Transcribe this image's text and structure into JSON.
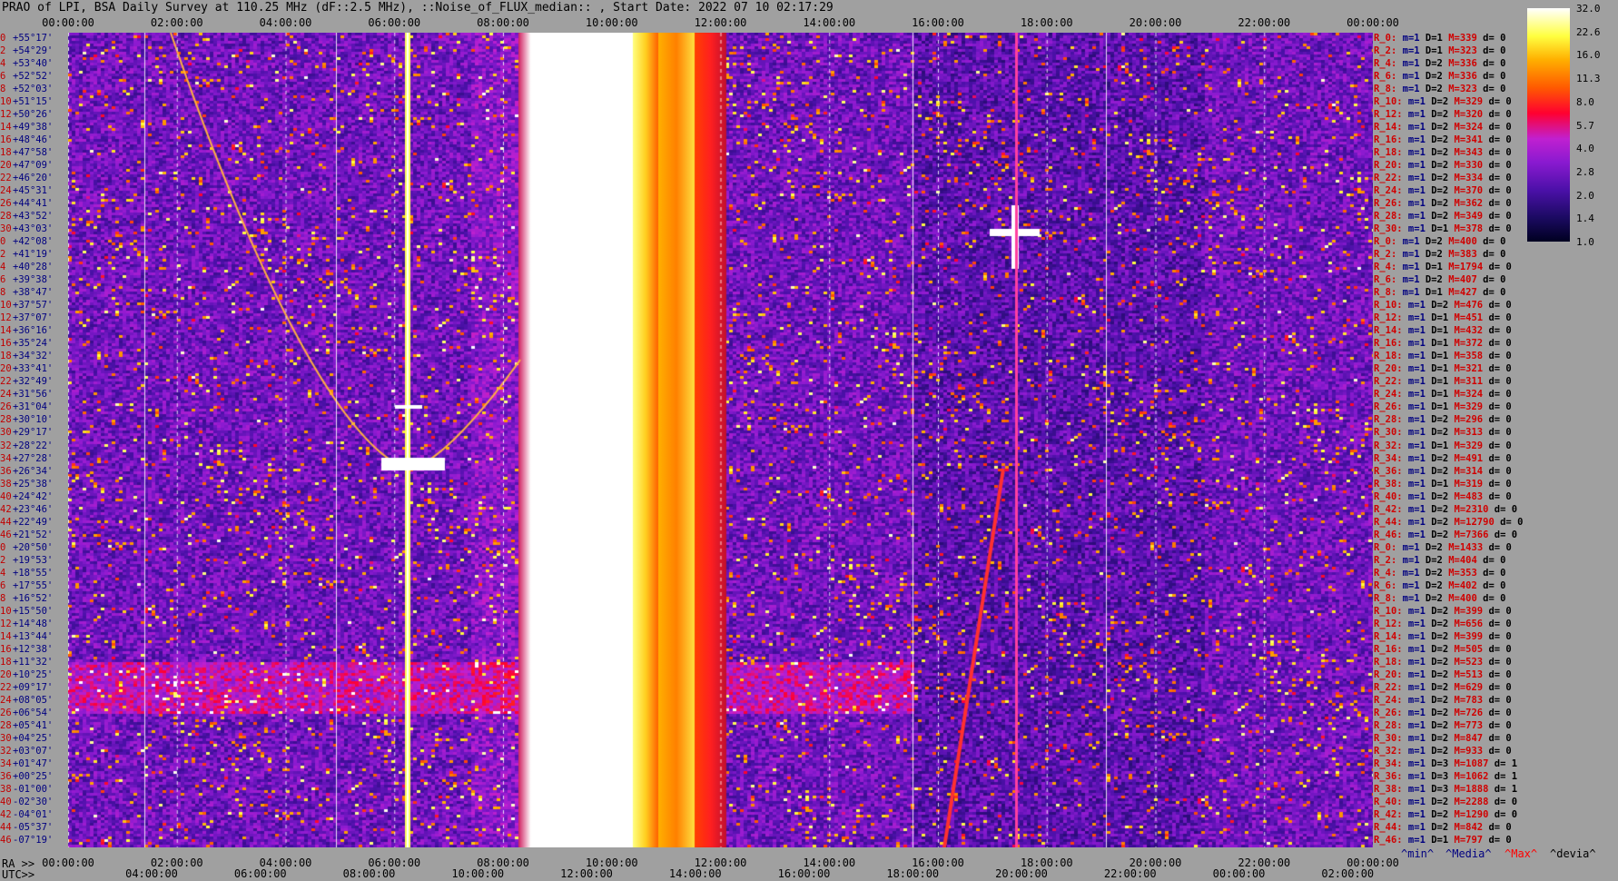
{
  "title": "PRAO of LPI, BSA Daily Survey at 110.25 MHz (dF::2.5 MHz), ::Noise_of_FLUX_median:: , Start Date: 2022 07 10 02:17:29",
  "chart_data": {
    "type": "heatmap",
    "title": "PRAO of LPI, BSA Daily Survey at 110.25 MHz (dF::2.5 MHz), ::Noise_of_FLUX_median:: , Start Date: 2022 07 10 02:17:29",
    "top_axis_ticks": [
      "00:00:00",
      "02:00:00",
      "04:00:00",
      "06:00:00",
      "08:00:00",
      "10:00:00",
      "12:00:00",
      "14:00:00",
      "16:00:00",
      "18:00:00",
      "20:00:00",
      "22:00:00",
      "00:00:00"
    ],
    "ra_axis_label": "RA >>",
    "ra_axis_ticks": [
      "00:00:00",
      "02:00:00",
      "04:00:00",
      "06:00:00",
      "08:00:00",
      "10:00:00",
      "12:00:00",
      "14:00:00",
      "16:00:00",
      "18:00:00",
      "20:00:00",
      "22:00:00",
      "00:00:00"
    ],
    "utc_axis_label": "UTC>>",
    "utc_axis_ticks": [
      "04:00:00",
      "06:00:00",
      "08:00:00",
      "10:00:00",
      "12:00:00",
      "14:00:00",
      "16:00:00",
      "18:00:00",
      "20:00:00",
      "22:00:00",
      "00:00:00",
      "02:00:00"
    ],
    "colorbar_ticks": [
      "32.0",
      "22.6",
      "16.0",
      "11.3",
      "8.0",
      "5.7",
      "4.0",
      "2.8",
      "2.0",
      "1.4",
      "1.0"
    ],
    "colorbar_range": [
      1.0,
      32.0
    ],
    "declination_labels": [
      "+55°17'",
      "+54°29'",
      "+53°40'",
      "+52°52'",
      "+52°03'",
      "+51°15'",
      "+50°26'",
      "+49°38'",
      "+48°46'",
      "+47°58'",
      "+47°09'",
      "+46°20'",
      "+45°31'",
      "+44°41'",
      "+43°52'",
      "+43°03'",
      "+42°08'",
      "+41°19'",
      "+40°28'",
      "+39°38'",
      "+38°47'",
      "+37°57'",
      "+37°07'",
      "+36°16'",
      "+35°24'",
      "+34°32'",
      "+33°41'",
      "+32°49'",
      "+31°56'",
      "+31°04'",
      "+30°10'",
      "+29°17'",
      "+28°22'",
      "+27°28'",
      "+26°34'",
      "+25°38'",
      "+24°42'",
      "+23°46'",
      "+22°49'",
      "+21°52'",
      "+20°50'",
      "+19°53'",
      "+18°55'",
      "+17°55'",
      "+16°52'",
      "+15°50'",
      "+14°48'",
      "+13°44'",
      "+12°38'",
      "+11°32'",
      "+10°25'",
      "+09°17'",
      "+08°05'",
      "+06°54'",
      "+05°41'",
      "+04°25'",
      "+03°07'",
      "+01°47'",
      "+00°25'",
      "-01°00'",
      "-02°30'",
      "-04°01'",
      "-05°37'",
      "-07°19'"
    ],
    "declination_indices": [
      "0",
      "2",
      "4",
      "6",
      "8",
      "10",
      "12",
      "14",
      "16",
      "18",
      "20",
      "22",
      "24",
      "26",
      "28",
      "30",
      "0",
      "2",
      "4",
      "6",
      "8",
      "10",
      "12",
      "14",
      "16",
      "18",
      "20",
      "22",
      "24",
      "26",
      "28",
      "30",
      "32",
      "34",
      "36",
      "38",
      "40",
      "42",
      "44",
      "46",
      "0",
      "2",
      "4",
      "6",
      "8",
      "10",
      "12",
      "14",
      "16",
      "18",
      "20",
      "22",
      "24",
      "26",
      "28",
      "30",
      "32",
      "34",
      "36",
      "38",
      "40",
      "42",
      "44",
      "46"
    ],
    "beam_stats": [
      {
        "label": "R_0:",
        "m": "m=1",
        "D": "D=1",
        "M": "M=339",
        "d": "d= 0"
      },
      {
        "label": "R_2:",
        "m": "m=1",
        "D": "D=1",
        "M": "M=323",
        "d": "d= 0"
      },
      {
        "label": "R_4:",
        "m": "m=1",
        "D": "D=2",
        "M": "M=336",
        "d": "d= 0"
      },
      {
        "label": "R_6:",
        "m": "m=1",
        "D": "D=2",
        "M": "M=336",
        "d": "d= 0"
      },
      {
        "label": "R_8:",
        "m": "m=1",
        "D": "D=2",
        "M": "M=323",
        "d": "d= 0"
      },
      {
        "label": "R_10:",
        "m": "m=1",
        "D": "D=2",
        "M": "M=329",
        "d": "d= 0"
      },
      {
        "label": "R_12:",
        "m": "m=1",
        "D": "D=2",
        "M": "M=320",
        "d": "d= 0"
      },
      {
        "label": "R_14:",
        "m": "m=1",
        "D": "D=2",
        "M": "M=324",
        "d": "d= 0"
      },
      {
        "label": "R_16:",
        "m": "m=1",
        "D": "D=2",
        "M": "M=341",
        "d": "d= 0"
      },
      {
        "label": "R_18:",
        "m": "m=1",
        "D": "D=2",
        "M": "M=343",
        "d": "d= 0"
      },
      {
        "label": "R_20:",
        "m": "m=1",
        "D": "D=2",
        "M": "M=330",
        "d": "d= 0"
      },
      {
        "label": "R_22:",
        "m": "m=1",
        "D": "D=2",
        "M": "M=334",
        "d": "d= 0"
      },
      {
        "label": "R_24:",
        "m": "m=1",
        "D": "D=2",
        "M": "M=370",
        "d": "d= 0"
      },
      {
        "label": "R_26:",
        "m": "m=1",
        "D": "D=2",
        "M": "M=362",
        "d": "d= 0"
      },
      {
        "label": "R_28:",
        "m": "m=1",
        "D": "D=2",
        "M": "M=349",
        "d": "d= 0"
      },
      {
        "label": "R_30:",
        "m": "m=1",
        "D": "D=1",
        "M": "M=378",
        "d": "d= 0"
      },
      {
        "label": "R_0:",
        "m": "m=1",
        "D": "D=2",
        "M": "M=400",
        "d": "d= 0"
      },
      {
        "label": "R_2:",
        "m": "m=1",
        "D": "D=2",
        "M": "M=383",
        "d": "d= 0"
      },
      {
        "label": "R_4:",
        "m": "m=1",
        "D": "D=1",
        "M": "M=1794",
        "d": "d= 0"
      },
      {
        "label": "R_6:",
        "m": "m=1",
        "D": "D=2",
        "M": "M=407",
        "d": "d= 0"
      },
      {
        "label": "R_8:",
        "m": "m=1",
        "D": "D=1",
        "M": "M=427",
        "d": "d= 0"
      },
      {
        "label": "R_10:",
        "m": "m=1",
        "D": "D=2",
        "M": "M=476",
        "d": "d= 0"
      },
      {
        "label": "R_12:",
        "m": "m=1",
        "D": "D=1",
        "M": "M=451",
        "d": "d= 0"
      },
      {
        "label": "R_14:",
        "m": "m=1",
        "D": "D=1",
        "M": "M=432",
        "d": "d= 0"
      },
      {
        "label": "R_16:",
        "m": "m=1",
        "D": "D=1",
        "M": "M=372",
        "d": "d= 0"
      },
      {
        "label": "R_18:",
        "m": "m=1",
        "D": "D=1",
        "M": "M=358",
        "d": "d= 0"
      },
      {
        "label": "R_20:",
        "m": "m=1",
        "D": "D=1",
        "M": "M=321",
        "d": "d= 0"
      },
      {
        "label": "R_22:",
        "m": "m=1",
        "D": "D=1",
        "M": "M=311",
        "d": "d= 0"
      },
      {
        "label": "R_24:",
        "m": "m=1",
        "D": "D=1",
        "M": "M=324",
        "d": "d= 0"
      },
      {
        "label": "R_26:",
        "m": "m=1",
        "D": "D=1",
        "M": "M=329",
        "d": "d= 0"
      },
      {
        "label": "R_28:",
        "m": "m=1",
        "D": "D=2",
        "M": "M=296",
        "d": "d= 0"
      },
      {
        "label": "R_30:",
        "m": "m=1",
        "D": "D=2",
        "M": "M=313",
        "d": "d= 0"
      },
      {
        "label": "R_32:",
        "m": "m=1",
        "D": "D=1",
        "M": "M=329",
        "d": "d= 0"
      },
      {
        "label": "R_34:",
        "m": "m=1",
        "D": "D=2",
        "M": "M=491",
        "d": "d= 0"
      },
      {
        "label": "R_36:",
        "m": "m=1",
        "D": "D=2",
        "M": "M=314",
        "d": "d= 0"
      },
      {
        "label": "R_38:",
        "m": "m=1",
        "D": "D=1",
        "M": "M=319",
        "d": "d= 0"
      },
      {
        "label": "R_40:",
        "m": "m=1",
        "D": "D=2",
        "M": "M=483",
        "d": "d= 0"
      },
      {
        "label": "R_42:",
        "m": "m=1",
        "D": "D=2",
        "M": "M=2310",
        "d": "d= 0"
      },
      {
        "label": "R_44:",
        "m": "m=1",
        "D": "D=2",
        "M": "M=12790",
        "d": "d= 0"
      },
      {
        "label": "R_46:",
        "m": "m=1",
        "D": "D=2",
        "M": "M=7366",
        "d": "d= 0"
      },
      {
        "label": "R_0:",
        "m": "m=1",
        "D": "D=2",
        "M": "M=1433",
        "d": "d= 0"
      },
      {
        "label": "R_2:",
        "m": "m=1",
        "D": "D=2",
        "M": "M=404",
        "d": "d= 0"
      },
      {
        "label": "R_4:",
        "m": "m=1",
        "D": "D=2",
        "M": "M=353",
        "d": "d= 0"
      },
      {
        "label": "R_6:",
        "m": "m=1",
        "D": "D=2",
        "M": "M=402",
        "d": "d= 0"
      },
      {
        "label": "R_8:",
        "m": "m=1",
        "D": "D=2",
        "M": "M=400",
        "d": "d= 0"
      },
      {
        "label": "R_10:",
        "m": "m=1",
        "D": "D=2",
        "M": "M=399",
        "d": "d= 0"
      },
      {
        "label": "R_12:",
        "m": "m=1",
        "D": "D=2",
        "M": "M=656",
        "d": "d= 0"
      },
      {
        "label": "R_14:",
        "m": "m=1",
        "D": "D=2",
        "M": "M=399",
        "d": "d= 0"
      },
      {
        "label": "R_16:",
        "m": "m=1",
        "D": "D=2",
        "M": "M=505",
        "d": "d= 0"
      },
      {
        "label": "R_18:",
        "m": "m=1",
        "D": "D=2",
        "M": "M=523",
        "d": "d= 0"
      },
      {
        "label": "R_20:",
        "m": "m=1",
        "D": "D=2",
        "M": "M=513",
        "d": "d= 0"
      },
      {
        "label": "R_22:",
        "m": "m=1",
        "D": "D=2",
        "M": "M=629",
        "d": "d= 0"
      },
      {
        "label": "R_24:",
        "m": "m=1",
        "D": "D=2",
        "M": "M=783",
        "d": "d= 0"
      },
      {
        "label": "R_26:",
        "m": "m=1",
        "D": "D=2",
        "M": "M=726",
        "d": "d= 0"
      },
      {
        "label": "R_28:",
        "m": "m=1",
        "D": "D=2",
        "M": "M=773",
        "d": "d= 0"
      },
      {
        "label": "R_30:",
        "m": "m=1",
        "D": "D=2",
        "M": "M=847",
        "d": "d= 0"
      },
      {
        "label": "R_32:",
        "m": "m=1",
        "D": "D=2",
        "M": "M=933",
        "d": "d= 0"
      },
      {
        "label": "R_34:",
        "m": "m=1",
        "D": "D=3",
        "M": "M=1087",
        "d": "d= 1"
      },
      {
        "label": "R_36:",
        "m": "m=1",
        "D": "D=3",
        "M": "M=1062",
        "d": "d= 1"
      },
      {
        "label": "R_38:",
        "m": "m=1",
        "D": "D=3",
        "M": "M=1888",
        "d": "d= 1"
      },
      {
        "label": "R_40:",
        "m": "m=1",
        "D": "D=2",
        "M": "M=2288",
        "d": "d= 0"
      },
      {
        "label": "R_42:",
        "m": "m=1",
        "D": "D=2",
        "M": "M=1290",
        "d": "d= 0"
      },
      {
        "label": "R_44:",
        "m": "m=1",
        "D": "D=2",
        "M": "M=842",
        "d": "d= 0"
      },
      {
        "label": "R_46:",
        "m": "m=1",
        "D": "D=1",
        "M": "M=797",
        "d": "d= 0"
      }
    ],
    "legend": {
      "min": "^min^",
      "media": "^Media^",
      "max": "^Max^",
      "devia": "^devia^"
    },
    "colors": {
      "background": "#a0a0a0",
      "label_red": "#d00000",
      "label_blue": "#000080"
    }
  }
}
